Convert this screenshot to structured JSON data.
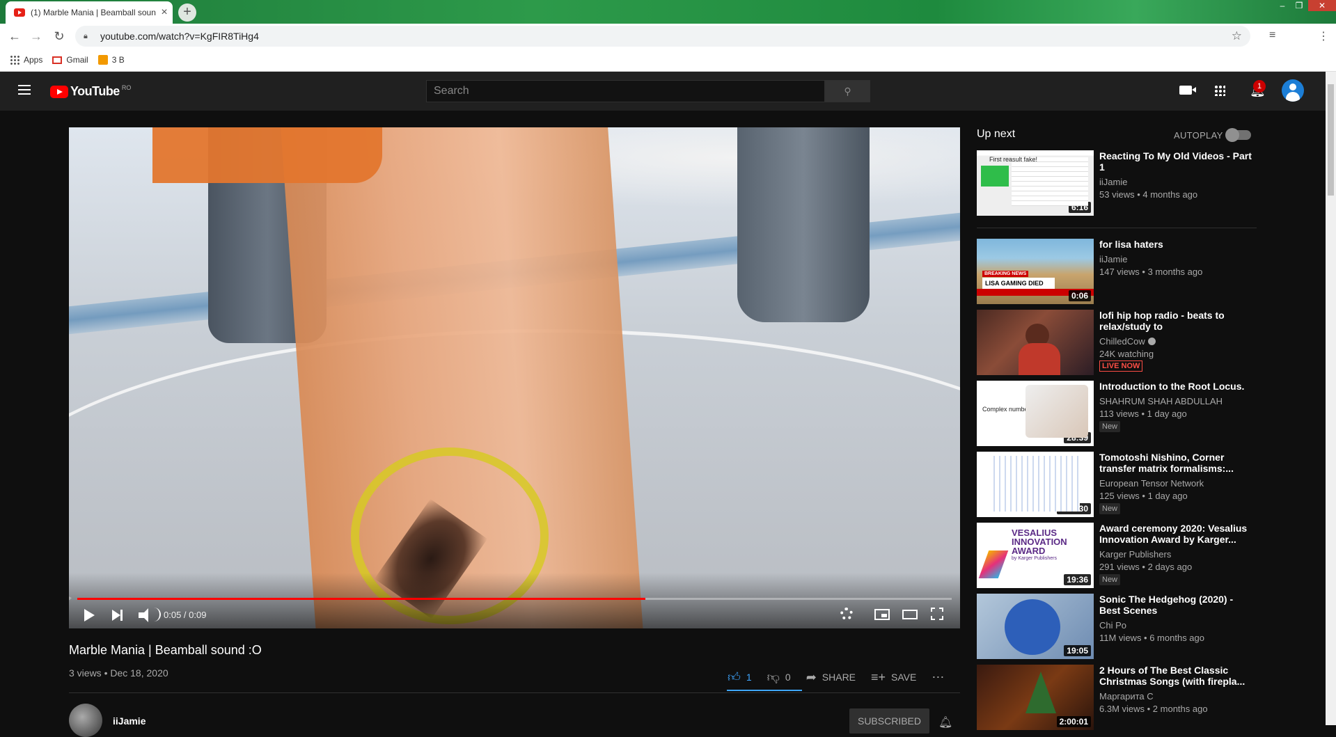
{
  "browser": {
    "tab_title": "(1) Marble Mania | Beamball soun",
    "url": "youtube.com/watch?v=KgFIR8TiHg4",
    "bookmarks": [
      {
        "label": "Apps"
      },
      {
        "label": "Gmail"
      },
      {
        "label": "3 B"
      }
    ]
  },
  "header": {
    "logo_text": "YouTube",
    "country_code": "RO",
    "search_placeholder": "Search",
    "notification_count": "1"
  },
  "player": {
    "time": "0:05 / 0:09",
    "progress_fraction": 0.65
  },
  "video": {
    "title": "Marble Mania | Beamball sound :O",
    "meta": "3 views • Dec 18, 2020",
    "likes": "1",
    "dislikes": "0",
    "share_label": "SHARE",
    "save_label": "SAVE",
    "channel_name": "iiJamie",
    "subscribed_label": "SUBSCRIBED"
  },
  "sidebar": {
    "up_next_label": "Up next",
    "autoplay_label": "AUTOPLAY",
    "items": [
      {
        "title": "Reacting To My Old Videos - Part 1",
        "channel": "iiJamie",
        "views": "53 views • 4 months ago",
        "duration": "6:16",
        "badge": ""
      },
      {
        "title": "for lisa haters",
        "channel": "iiJamie",
        "views": "147 views • 3 months ago",
        "duration": "0:06",
        "badge": ""
      },
      {
        "title": "lofi hip hop radio - beats to relax/study to",
        "channel": "ChilledCow",
        "views": "24K watching",
        "duration": "",
        "badge": "LIVE NOW"
      },
      {
        "title": "Introduction to the Root Locus.",
        "channel": "SHAHRUM SHAH ABDULLAH",
        "views": "113 views • 1 day ago",
        "duration": "28:39",
        "badge": "New"
      },
      {
        "title": "Tomotoshi Nishino, Corner transfer matrix formalisms:...",
        "channel": "European Tensor Network",
        "views": "125 views • 1 day ago",
        "duration": "1:15:30",
        "badge": "New"
      },
      {
        "title": "Award ceremony 2020: Vesalius Innovation Award by Karger...",
        "channel": "Karger Publishers",
        "views": "291 views • 2 days ago",
        "duration": "19:36",
        "badge": "New"
      },
      {
        "title": "Sonic The Hedgehog (2020) - Best Scenes",
        "channel": "Chi Po",
        "views": "11M views • 6 months ago",
        "duration": "19:05",
        "badge": ""
      },
      {
        "title": "2 Hours of The Best Classic Christmas Songs (with firepla...",
        "channel": "Маргарита С",
        "views": "6.3M views • 2 months ago",
        "duration": "2:00:01",
        "badge": ""
      }
    ],
    "thumb_texts": {
      "t1": "First reasult fake!",
      "t2_breaking": "BREAKING NEWS",
      "t2_news": "LISA GAMING DIED",
      "t4": "Complex number review",
      "t6_title": "VESALIUS INNOVATION AWARD",
      "t6_sub": "by Karger Publishers"
    }
  },
  "icons": {
    "accent": "#3ea6ff",
    "brand": "#ff0000"
  }
}
